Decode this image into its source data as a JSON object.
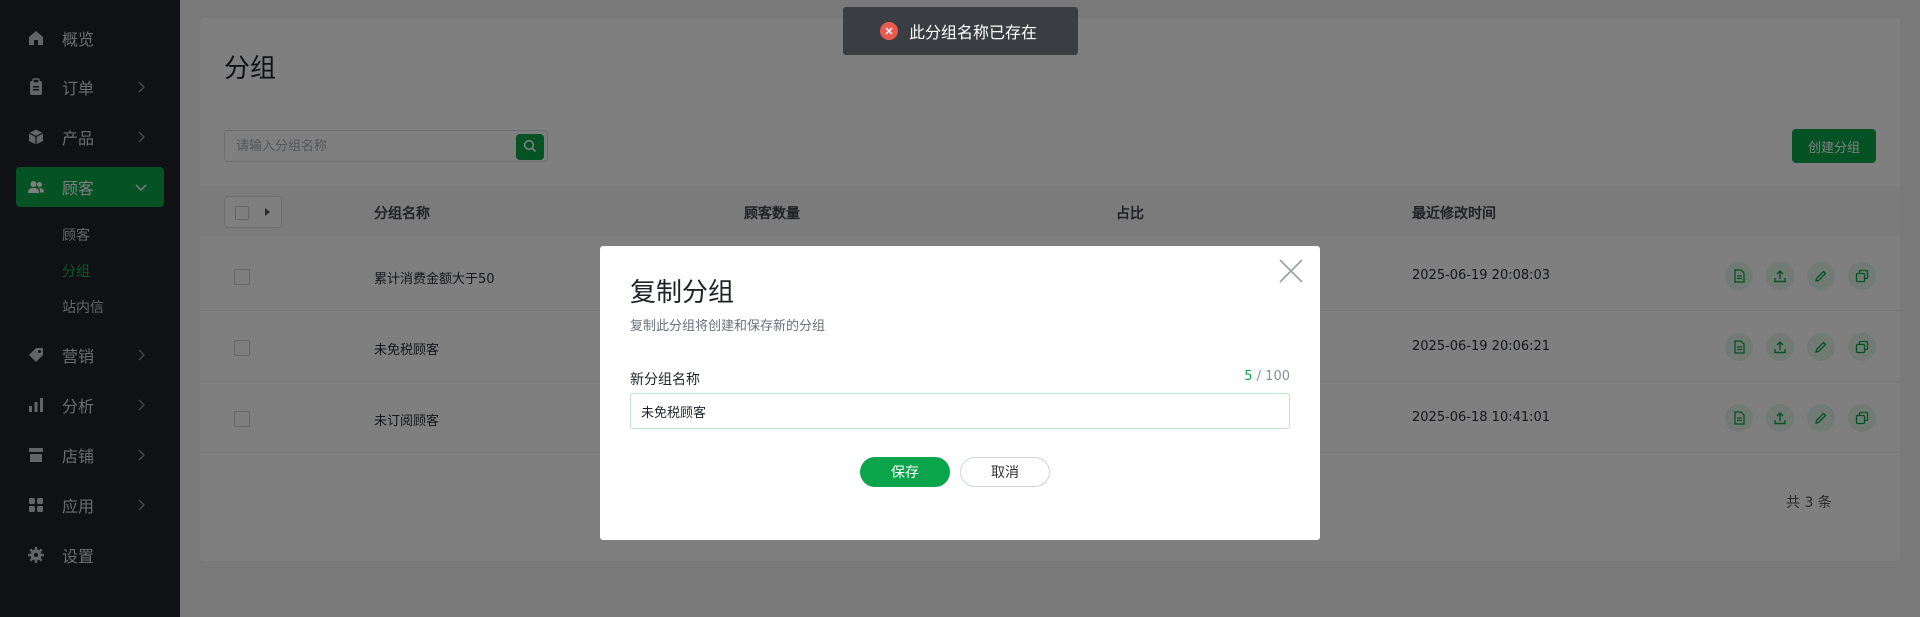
{
  "sidebar": {
    "items": [
      {
        "label": "概览",
        "icon": "home-icon"
      },
      {
        "label": "订单",
        "icon": "clipboard-icon"
      },
      {
        "label": "产品",
        "icon": "box-icon"
      },
      {
        "label": "顾客",
        "icon": "users-icon"
      },
      {
        "label": "营销",
        "icon": "tag-icon"
      },
      {
        "label": "分析",
        "icon": "bar-chart-icon"
      },
      {
        "label": "店铺",
        "icon": "store-icon"
      },
      {
        "label": "应用",
        "icon": "apps-icon"
      },
      {
        "label": "设置",
        "icon": "gear-icon"
      }
    ],
    "customer_sub": [
      "顾客",
      "分组",
      "站内信"
    ]
  },
  "page": {
    "title": "分组",
    "search_placeholder": "请输入分组名称",
    "create_label": "创建分组",
    "columns": [
      "分组名称",
      "顾客数量",
      "占比",
      "最近修改时间"
    ],
    "rows": [
      {
        "name": "累计消费金额大于50",
        "modified": "2025-06-19 20:08:03"
      },
      {
        "name": "未免税顾客",
        "modified": "2025-06-19 20:06:21"
      },
      {
        "name": "未订阅顾客",
        "modified": "2025-06-18 10:41:01"
      }
    ],
    "total": "共 3 条"
  },
  "modal": {
    "title": "复制分组",
    "subtitle": "复制此分组将创建和保存新的分组",
    "field_label": "新分组名称",
    "field_value": "未免税顾客",
    "counter_current": "5",
    "counter_max": "/ 100",
    "save_label": "保存",
    "cancel_label": "取消"
  },
  "toast": {
    "message": "此分组名称已存在"
  },
  "colors": {
    "accent": "#0aa44a",
    "sidebar_bg": "#1f2328",
    "error": "#e85a4f"
  }
}
